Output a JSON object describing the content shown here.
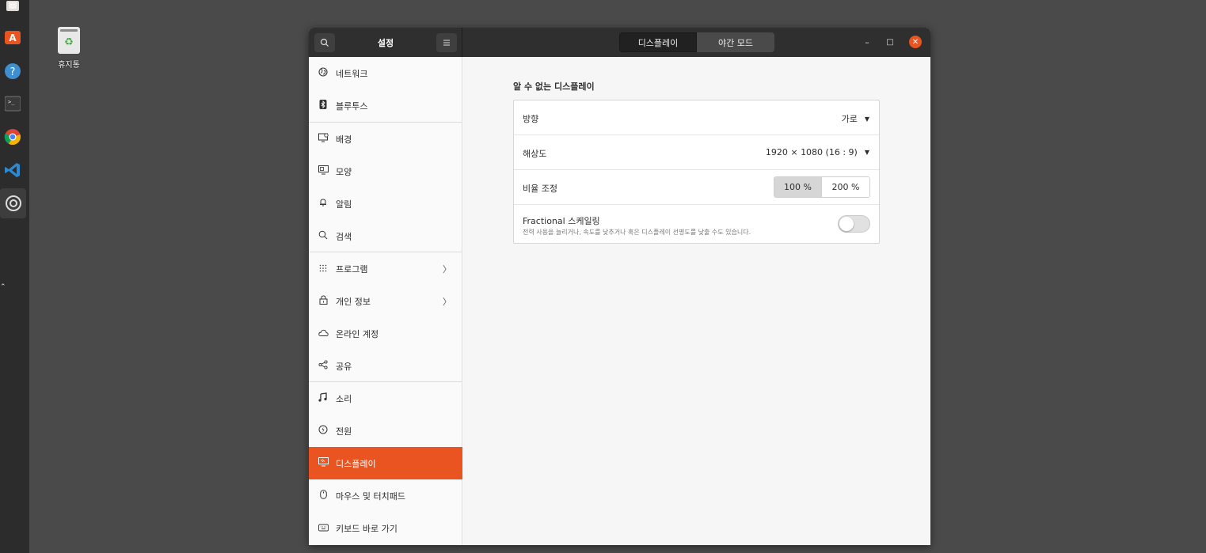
{
  "desktop": {
    "trash_label": "휴지통"
  },
  "dock": {
    "items": [
      {
        "name": "files-icon"
      },
      {
        "name": "software-store-icon"
      },
      {
        "name": "help-icon"
      },
      {
        "name": "terminal-icon"
      },
      {
        "name": "chrome-icon"
      },
      {
        "name": "vscode-icon"
      },
      {
        "name": "settings-icon"
      }
    ]
  },
  "titlebar": {
    "title": "설정",
    "tabs": [
      "디스플레이",
      "야간 모드"
    ],
    "controls": {
      "minimize": "–",
      "maximize": "□",
      "close": "✕"
    }
  },
  "sidebar": {
    "items": [
      {
        "label": "네트워크",
        "icon": "globe-icon"
      },
      {
        "label": "블루투스",
        "icon": "bluetooth-icon"
      },
      {
        "label": "배경",
        "icon": "background-icon"
      },
      {
        "label": "모양",
        "icon": "appearance-icon"
      },
      {
        "label": "알림",
        "icon": "bell-icon"
      },
      {
        "label": "검색",
        "icon": "search-icon"
      },
      {
        "label": "프로그램",
        "icon": "apps-grid-icon",
        "chevron": "〉"
      },
      {
        "label": "개인 정보",
        "icon": "lock-icon",
        "chevron": "〉"
      },
      {
        "label": "온라인 계정",
        "icon": "cloud-icon"
      },
      {
        "label": "공유",
        "icon": "share-icon"
      },
      {
        "label": "소리",
        "icon": "music-note-icon"
      },
      {
        "label": "전원",
        "icon": "power-icon"
      },
      {
        "label": "디스플레이",
        "icon": "display-icon",
        "active": true
      },
      {
        "label": "마우스 및 터치패드",
        "icon": "mouse-icon"
      },
      {
        "label": "키보드 바로 가기",
        "icon": "keyboard-icon"
      }
    ]
  },
  "display": {
    "section_title": "알 수 없는 디스플레이",
    "orientation": {
      "label": "방향",
      "value": "가로"
    },
    "resolution": {
      "label": "해상도",
      "value": "1920 × 1080 (16 : 9)"
    },
    "scale": {
      "label": "비율 조정",
      "options": [
        "100 %",
        "200 %"
      ],
      "selected": "100 %"
    },
    "fractional": {
      "title": "Fractional 스케일링",
      "subtitle": "전력 사용을 늘리거나, 속도를 낮추거나 혹은 디스플레이 선명도를 낮출 수도 있습니다.",
      "enabled": false
    }
  },
  "colors": {
    "accent": "#e95420",
    "titlebar": "#2f2f2f",
    "desktop": "#4a4a4a"
  }
}
